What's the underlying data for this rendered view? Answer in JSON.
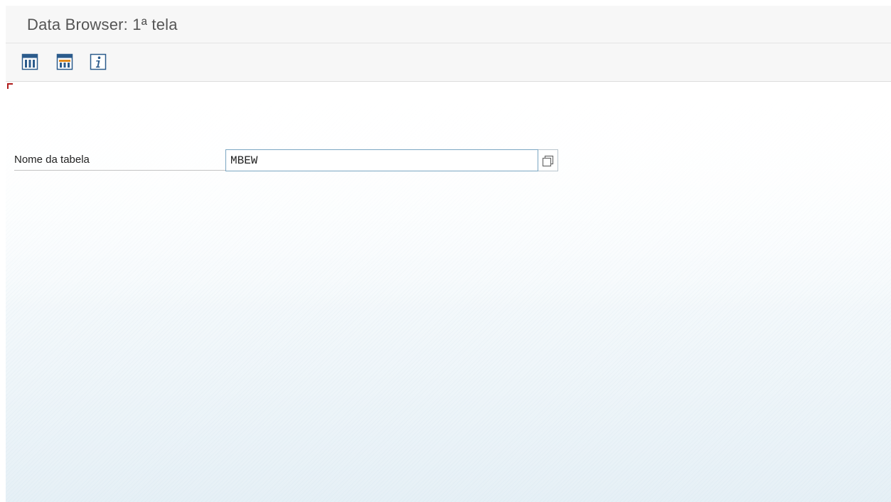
{
  "window": {
    "title": "Data Browser: 1ª tela"
  },
  "toolbar": {
    "buttons": [
      {
        "icon": "table-contents-icon"
      },
      {
        "icon": "table-fields-icon"
      },
      {
        "icon": "info-icon"
      }
    ]
  },
  "form": {
    "table_name": {
      "label": "Nome da tabela",
      "value": "MBEW"
    }
  },
  "colors": {
    "title_text": "#555555",
    "input_border": "#7aa6c2",
    "icon_blue": "#2b5b8c",
    "icon_orange": "#e08a1e",
    "corner_red": "#b01c1c"
  }
}
